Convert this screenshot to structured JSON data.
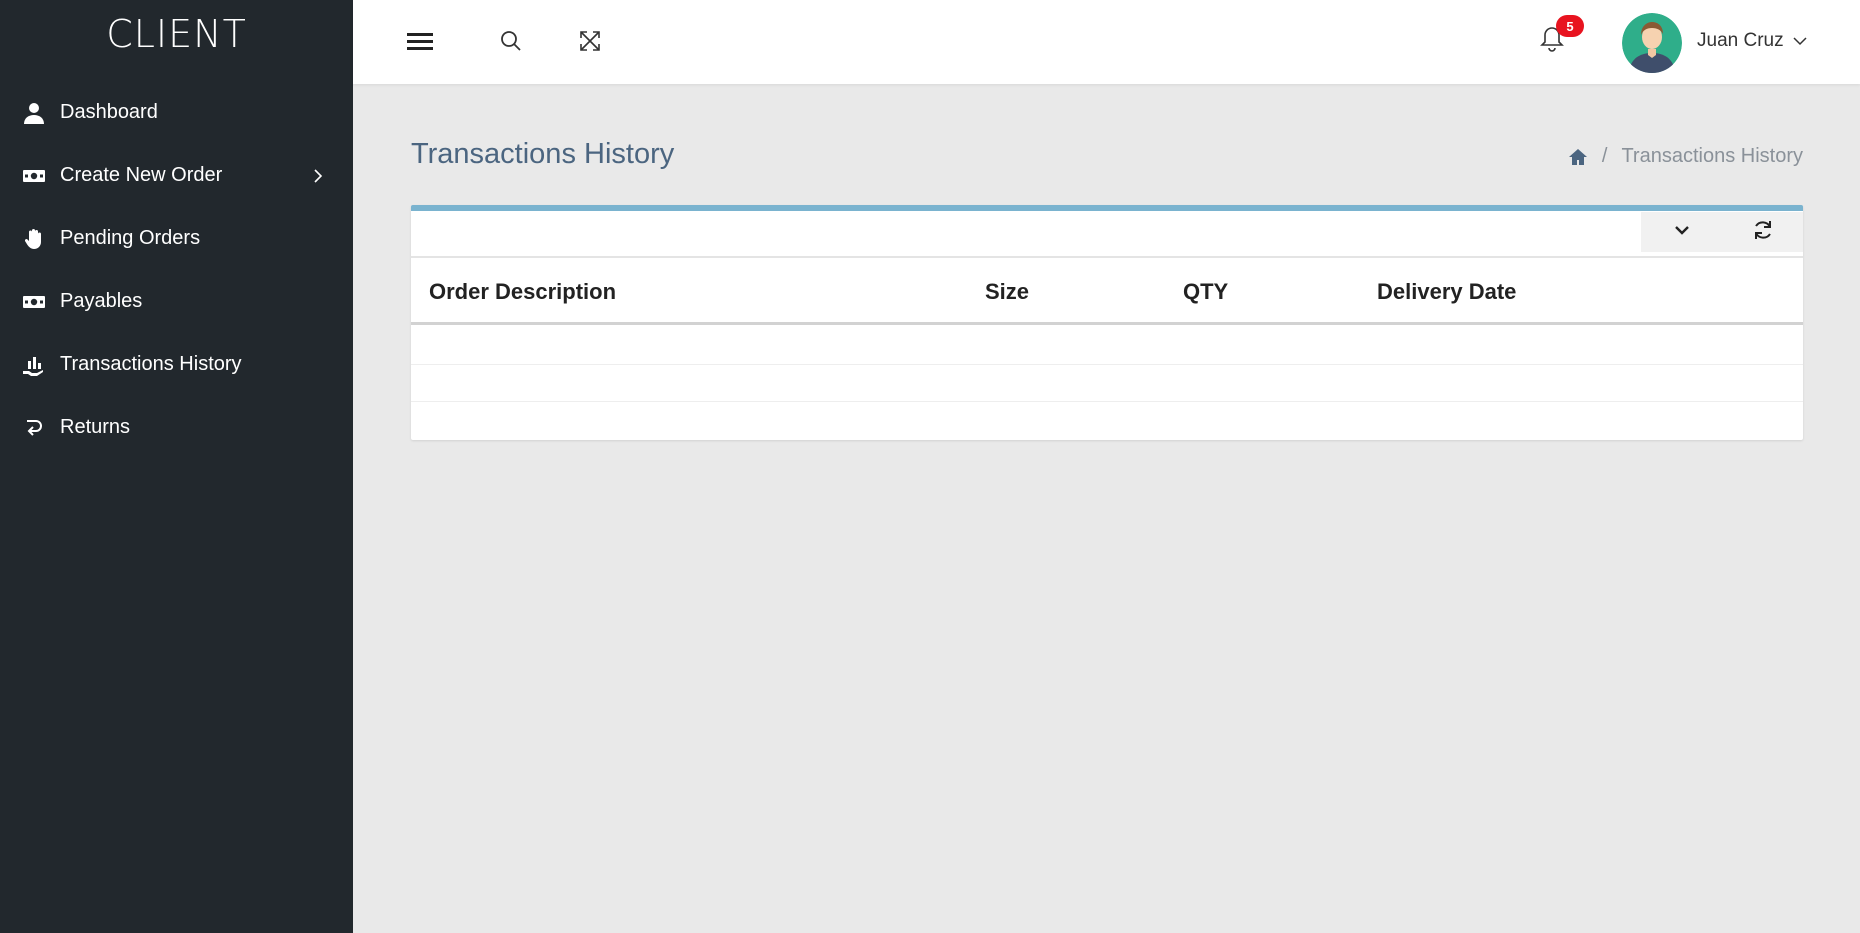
{
  "brand": "CLIENT",
  "sidebar": {
    "items": [
      {
        "label": "Dashboard",
        "icon": "user-icon"
      },
      {
        "label": "Create New Order",
        "icon": "money-icon",
        "has_submenu": true
      },
      {
        "label": "Pending Orders",
        "icon": "hand-icon"
      },
      {
        "label": "Payables",
        "icon": "money-icon"
      },
      {
        "label": "Transactions History",
        "icon": "hand-holding-chart-icon"
      },
      {
        "label": "Returns",
        "icon": "return-icon"
      }
    ]
  },
  "topbar": {
    "notification_count": "5",
    "user_name": "Juan Cruz"
  },
  "page": {
    "title": "Transactions History",
    "breadcrumb_current": "Transactions History",
    "breadcrumb_separator": "/"
  },
  "table": {
    "columns": [
      "Order Description",
      "Size",
      "QTY",
      "Delivery Date"
    ]
  },
  "colors": {
    "sidebar_bg": "#22282d",
    "accent": "#7ab3cf",
    "title": "#4b6580",
    "badge": "#e8131f"
  }
}
